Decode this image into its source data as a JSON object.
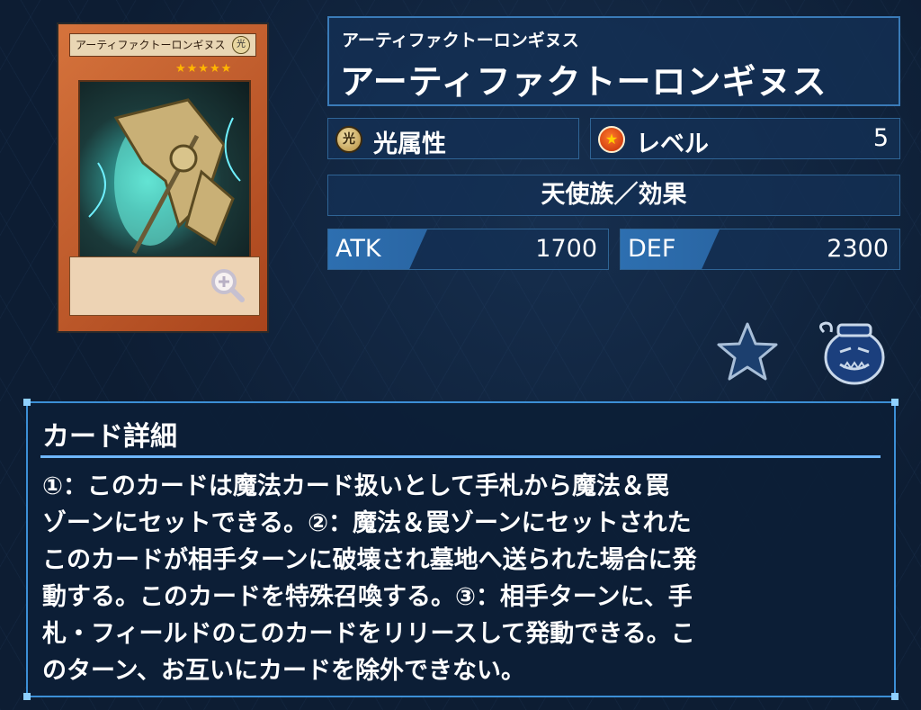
{
  "card": {
    "image_name": "アーティファクトーロンギヌス",
    "image_attr": "光",
    "stars": "★★★★★"
  },
  "name_kana": "アーティファクトーロンギヌス",
  "name": "アーティファクトーロンギヌス",
  "attribute": {
    "icon": "light-attribute-icon",
    "label": "光属性"
  },
  "level": {
    "icon": "level-star-icon",
    "label": "レベル",
    "value": "5"
  },
  "type_line": "天使族／効果",
  "atk": {
    "label": "ATK",
    "value": "1700"
  },
  "def": {
    "label": "DEF",
    "value": "2300"
  },
  "detail": {
    "title": "カード詳細",
    "lines": [
      "①：このカードは魔法カード扱いとして手札から魔法＆罠",
      "ゾーンにセットできる。②：魔法＆罠ゾーンにセットされた",
      "このカードが相手ターンに破壊され墓地へ送られた場合に発",
      "動する。このカードを特殊召喚する。③：相手ターンに、手",
      "札・フィールドのこのカードをリリースして発動できる。こ",
      "のターン、お互いにカードを除外できない。"
    ]
  },
  "colors": {
    "panel": "#14305a",
    "accent": "#3c8fd6",
    "background": "#0d1d33"
  }
}
